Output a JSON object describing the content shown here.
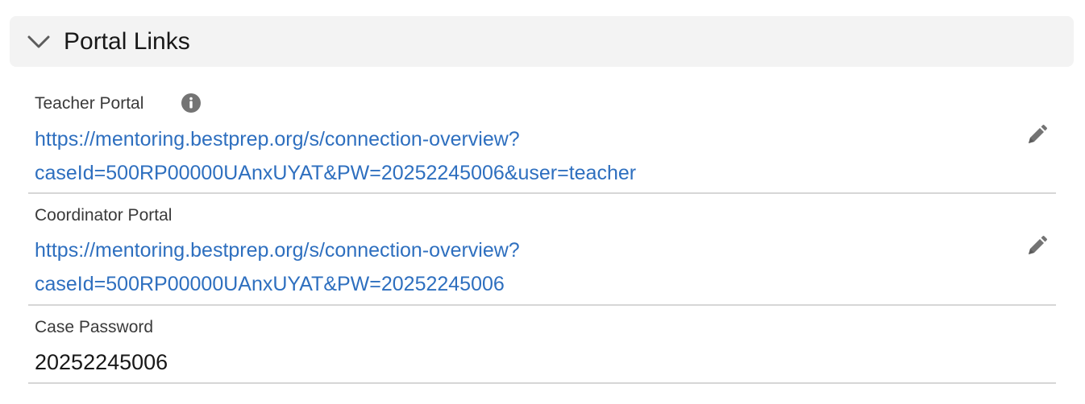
{
  "section": {
    "title": "Portal Links",
    "expanded_icon": "chevron-down-icon"
  },
  "fields": [
    {
      "label": "Teacher Portal",
      "has_help": true,
      "link_line1": "https://mentoring.bestprep.org/s/connection-overview?",
      "link_line2": "caseId=500RP00000UAnxUYAT&PW=20252245006&user=teacher",
      "edit_icon": "pencil-icon"
    },
    {
      "label": "Coordinator Portal",
      "link_line1": "https://mentoring.bestprep.org/s/connection-overview?",
      "link_line2": "caseId=500RP00000UAnxUYAT&PW=20252245006",
      "edit_icon": "pencil-icon"
    },
    {
      "label": "Case Password",
      "value": "20252245006"
    }
  ],
  "colors": {
    "header_bg": "#f3f3f3",
    "link": "#2e6fbf",
    "divider": "#d6d6d6",
    "icon": "#747474"
  }
}
